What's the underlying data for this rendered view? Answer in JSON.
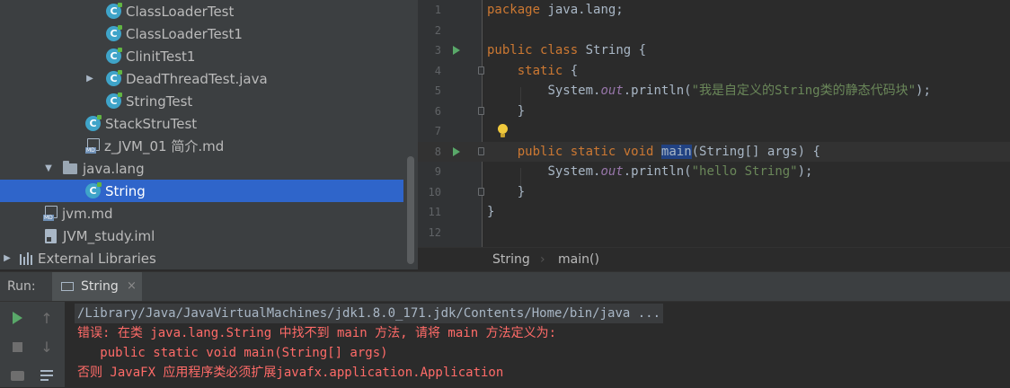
{
  "project_tree": {
    "items": [
      {
        "label": "ClassLoaderTest",
        "icon": "java-class-icon",
        "selected": false
      },
      {
        "label": "ClassLoaderTest1",
        "icon": "java-class-icon",
        "selected": false
      },
      {
        "label": "ClinitTest1",
        "icon": "java-class-icon",
        "selected": false
      },
      {
        "label": "DeadThreadTest.java",
        "icon": "java-class-icon",
        "collapsed": true,
        "selected": false
      },
      {
        "label": "StringTest",
        "icon": "java-class-icon",
        "selected": false
      },
      {
        "label": "StackStruTest",
        "icon": "java-class-icon",
        "selected": false
      },
      {
        "label": "z_JVM_01 简介.md",
        "icon": "markdown-file-icon",
        "selected": false
      },
      {
        "label": "java.lang",
        "icon": "package-folder-icon",
        "expanded": true,
        "selected": false
      },
      {
        "label": "String",
        "icon": "java-class-icon",
        "selected": true
      },
      {
        "label": "jvm.md",
        "icon": "markdown-file-icon",
        "selected": false
      },
      {
        "label": "JVM_study.iml",
        "icon": "iml-file-icon",
        "selected": false
      },
      {
        "label": "External Libraries",
        "icon": "library-icon",
        "collapsed": true,
        "selected": false
      }
    ]
  },
  "editor": {
    "lines": [
      {
        "number": "1",
        "text": "package java.lang;"
      },
      {
        "number": "2",
        "text": ""
      },
      {
        "number": "3",
        "text": "public class String {"
      },
      {
        "number": "4",
        "text": "    static {"
      },
      {
        "number": "5",
        "text": "        System.out.println(\"我是自定义的String类的静态代码块\");"
      },
      {
        "number": "6",
        "text": "    }"
      },
      {
        "number": "7",
        "text": ""
      },
      {
        "number": "8",
        "text": "    public static void main(String[] args) {"
      },
      {
        "number": "9",
        "text": "        System.out.println(\"hello String\");"
      },
      {
        "number": "10",
        "text": "    }"
      },
      {
        "number": "11",
        "text": "}"
      },
      {
        "number": "12",
        "text": ""
      }
    ],
    "tokens": {
      "package_kw": "package",
      "package_name": " java.lang;",
      "public": "public",
      "class": "class",
      "static": "static",
      "void": "void",
      "class_name": " String {",
      "open_brace": " {",
      "system": "System.",
      "out": "out",
      "println": ".println(",
      "str_static": "\"我是自定义的String类的静态代码块\"",
      "str_hello": "\"hello String\"",
      "end_stmt": ");",
      "main": "main",
      "main_params": "(String[] args) {",
      "close_brace": "}"
    }
  },
  "breadcrumb": {
    "items": [
      "String",
      "main()"
    ]
  },
  "run_panel": {
    "label": "Run:",
    "tab_label": "String",
    "tab_close": "×",
    "console_lines": [
      "/Library/Java/JavaVirtualMachines/jdk1.8.0_171.jdk/Contents/Home/bin/java ...",
      "错误: 在类 java.lang.String 中找不到 main 方法, 请将 main 方法定义为:",
      "   public static void main(String[] args)",
      "否则 JavaFX 应用程序类必须扩展javafx.application.Application"
    ]
  },
  "colors": {
    "selection": "#2f65ca",
    "error_text": "#ff6b68",
    "keyword": "#cc7832",
    "string": "#6a8759",
    "run_green": "#59a869"
  }
}
